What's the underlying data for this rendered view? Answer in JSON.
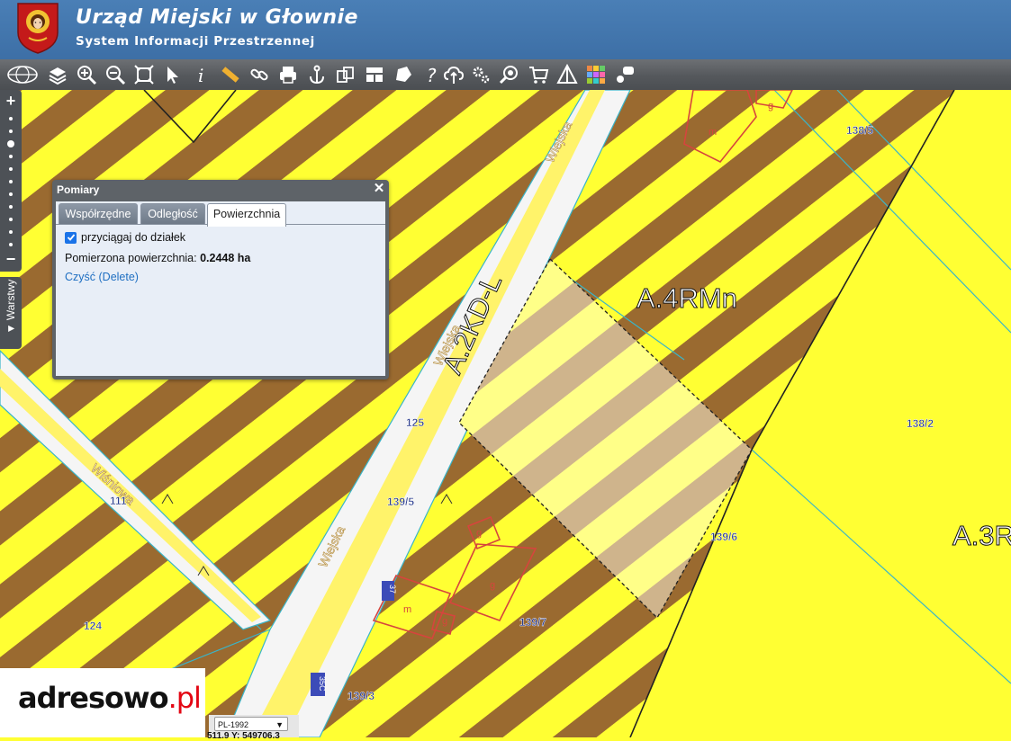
{
  "header": {
    "title": "Urząd Miejski w Głownie",
    "subtitle": "System Informacji Przestrzennej"
  },
  "toolbar": {
    "tools": [
      {
        "name": "globe-icon"
      },
      {
        "name": "layers-icon"
      },
      {
        "name": "zoom-in-icon"
      },
      {
        "name": "zoom-out-icon"
      },
      {
        "name": "zoom-extent-icon"
      },
      {
        "name": "pointer-icon"
      },
      {
        "name": "info-icon"
      },
      {
        "name": "ruler-icon"
      },
      {
        "name": "link-icon"
      },
      {
        "name": "print-icon"
      },
      {
        "name": "anchor-icon"
      },
      {
        "name": "compare-icon"
      },
      {
        "name": "layout-icon"
      },
      {
        "name": "shape-icon"
      },
      {
        "name": "help-icon"
      },
      {
        "name": "cloud-upload-icon"
      },
      {
        "name": "settings-icon"
      },
      {
        "name": "search-map-icon"
      },
      {
        "name": "cart-icon"
      },
      {
        "name": "triangle-icon"
      },
      {
        "name": "grid-colors-icon"
      },
      {
        "name": "chat-icon"
      }
    ]
  },
  "sidebar": {
    "zoom_in": "+",
    "zoom_out": "−",
    "layers_tab": "▼ Warstwy"
  },
  "dialog": {
    "title": "Pomiary",
    "tabs": [
      "Współrzędne",
      "Odległość",
      "Powierzchnia"
    ],
    "active_tab": "Powierzchnia",
    "snap_label": "przyciągaj do działek",
    "snap_checked": true,
    "result_label": "Pomierzona powierzchnia:",
    "result_value": "0.2448 ha",
    "clear_label": "Czyść (Delete)"
  },
  "map": {
    "zone_labels": [
      "A.4RMn",
      "A.2KD-L",
      "A.3R"
    ],
    "street_labels": [
      "Wiejska",
      "Wiejska",
      "Wiejska",
      "Wiśniowa"
    ],
    "parcel_labels": [
      "138/5",
      "138/2",
      "125",
      "139/5",
      "139/6",
      "139/7",
      "139/3",
      "124",
      "111"
    ],
    "building_labels": [
      "m",
      "g",
      "g",
      "g",
      "m",
      "g"
    ],
    "house_numbers": [
      "37",
      "35C"
    ],
    "colors": {
      "zone_yellow": "#ffff33",
      "stripe_brown": "#9a6a30",
      "measure_fill": "#fff6a0"
    }
  },
  "footer": {
    "brand_main": "adresowo",
    "brand_dot": ".",
    "brand_tld": "pl",
    "crs": "PL-1992",
    "coords_text": "511.9   Y: 549706.3"
  }
}
